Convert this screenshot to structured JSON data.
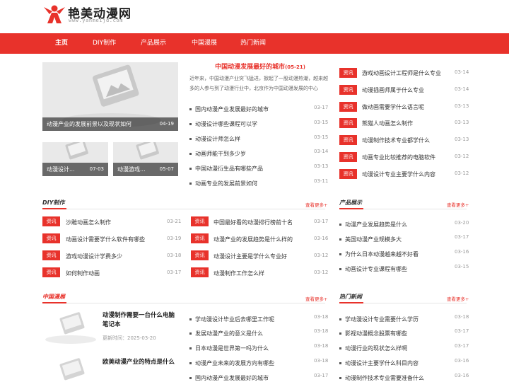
{
  "site": {
    "title": "艳美动漫网",
    "subtitle": "www.yanmeijd.com"
  },
  "nav": [
    "主页",
    "DIY制作",
    "产品展示",
    "中国漫展",
    "热门新闻"
  ],
  "hero": {
    "main": {
      "title": "动漫产业的发展前景以及现状如何",
      "date": "04-19"
    },
    "small1": {
      "title": "动漫设计...",
      "date": "07-03"
    },
    "small2": {
      "title": "动漫游戏...",
      "date": "05-07"
    }
  },
  "featured": {
    "title": "中国动漫发展最好的城市",
    "date": "(05-21)",
    "summary": "近年来，中国动漫产业突飞猛进，掀起了一股动漫热潮，越来越多的人参与到了动漫行业中，北京作为中国动漫发展的中心",
    "list": [
      {
        "text": "国内动漫产业发展最好的城市",
        "date": "03-17"
      },
      {
        "text": "动漫设计哪些课程可以学",
        "date": "03-15"
      },
      {
        "text": "动漫设计师怎么样",
        "date": "03-15"
      },
      {
        "text": "动画师能干到多少岁",
        "date": "03-14"
      },
      {
        "text": "中国动漫衍生品有哪些产品",
        "date": "03-13"
      },
      {
        "text": "动画专业的发展前景如何",
        "date": "03-11"
      }
    ]
  },
  "tag_label": "资讯",
  "right_news": [
    {
      "text": "游戏动画设计工程师是什么专业",
      "date": "03-14"
    },
    {
      "text": "动漫插画师属于什么专业",
      "date": "03-14"
    },
    {
      "text": "做动画需要学什么语言呢",
      "date": "03-13"
    },
    {
      "text": "熊猫人动画怎么制作",
      "date": "03-13"
    },
    {
      "text": "动漫制作技术专业都学什么",
      "date": "03-13"
    },
    {
      "text": "动画专业比较推荐的电脑软件",
      "date": "03-12"
    },
    {
      "text": "动漫设计专业主要学什么内容",
      "date": "03-12"
    }
  ],
  "more": "查看更多+",
  "diy": {
    "title": "DIY制作",
    "left": [
      {
        "text": "沙雕动画怎么制作",
        "date": "03-21"
      },
      {
        "text": "动画设计需要学什么软件有哪些",
        "date": "03-19"
      },
      {
        "text": "游戏动漫设计学费多少",
        "date": "03-18"
      },
      {
        "text": "如何制作动画",
        "date": "03-17"
      }
    ],
    "right": [
      {
        "text": "中国最好看的动漫排行榜前十名",
        "date": "03-17"
      },
      {
        "text": "动漫产业的发展趋势是什么样的",
        "date": "03-16"
      },
      {
        "text": "动漫设计主要是学什么专业好",
        "date": "03-12"
      },
      {
        "text": "动漫制作工作怎么样",
        "date": "03-12"
      }
    ]
  },
  "products": {
    "title": "产品展示",
    "list": [
      {
        "text": "动漫产业发展趋势是什么",
        "date": "03-20"
      },
      {
        "text": "美国动漫产业规模多大",
        "date": "03-17"
      },
      {
        "text": "为什么日本动漫越来越不好看",
        "date": "03-16"
      },
      {
        "text": "动画设计专业课程有哪些",
        "date": "03-15"
      }
    ]
  },
  "expo": {
    "title": "中国漫展",
    "article1": {
      "title": "动漫制作需要一台什么电脑笔记本",
      "time_label": "更新时间：",
      "time": "2025-03-20"
    },
    "article2": {
      "title": "欧美动漫产业的特点是什么"
    },
    "list": [
      {
        "text": "学动漫设计毕业后去哪里工作呢",
        "date": "03-18"
      },
      {
        "text": "发展动漫产业的意义是什么",
        "date": "03-18"
      },
      {
        "text": "日本动漫是世界第一吗为什么",
        "date": "03-18"
      },
      {
        "text": "动漫产业未来的发展方向有哪些",
        "date": "03-18"
      },
      {
        "text": "国内动漫产业发展最好的城市",
        "date": "03-17"
      }
    ]
  },
  "hot": {
    "title": "热门新闻",
    "list": [
      {
        "text": "学动漫设计专业需要什么学历",
        "date": "03-18"
      },
      {
        "text": "影视动漫概念股票有哪些",
        "date": "03-17"
      },
      {
        "text": "动漫行业的现状怎么样啊",
        "date": "03-17"
      },
      {
        "text": "动漫设计主要学什么科目内容",
        "date": "03-16"
      },
      {
        "text": "动漫制作技术专业需要准备什么",
        "date": "03-16"
      }
    ]
  },
  "colors": {
    "accent": "#e8322b"
  }
}
